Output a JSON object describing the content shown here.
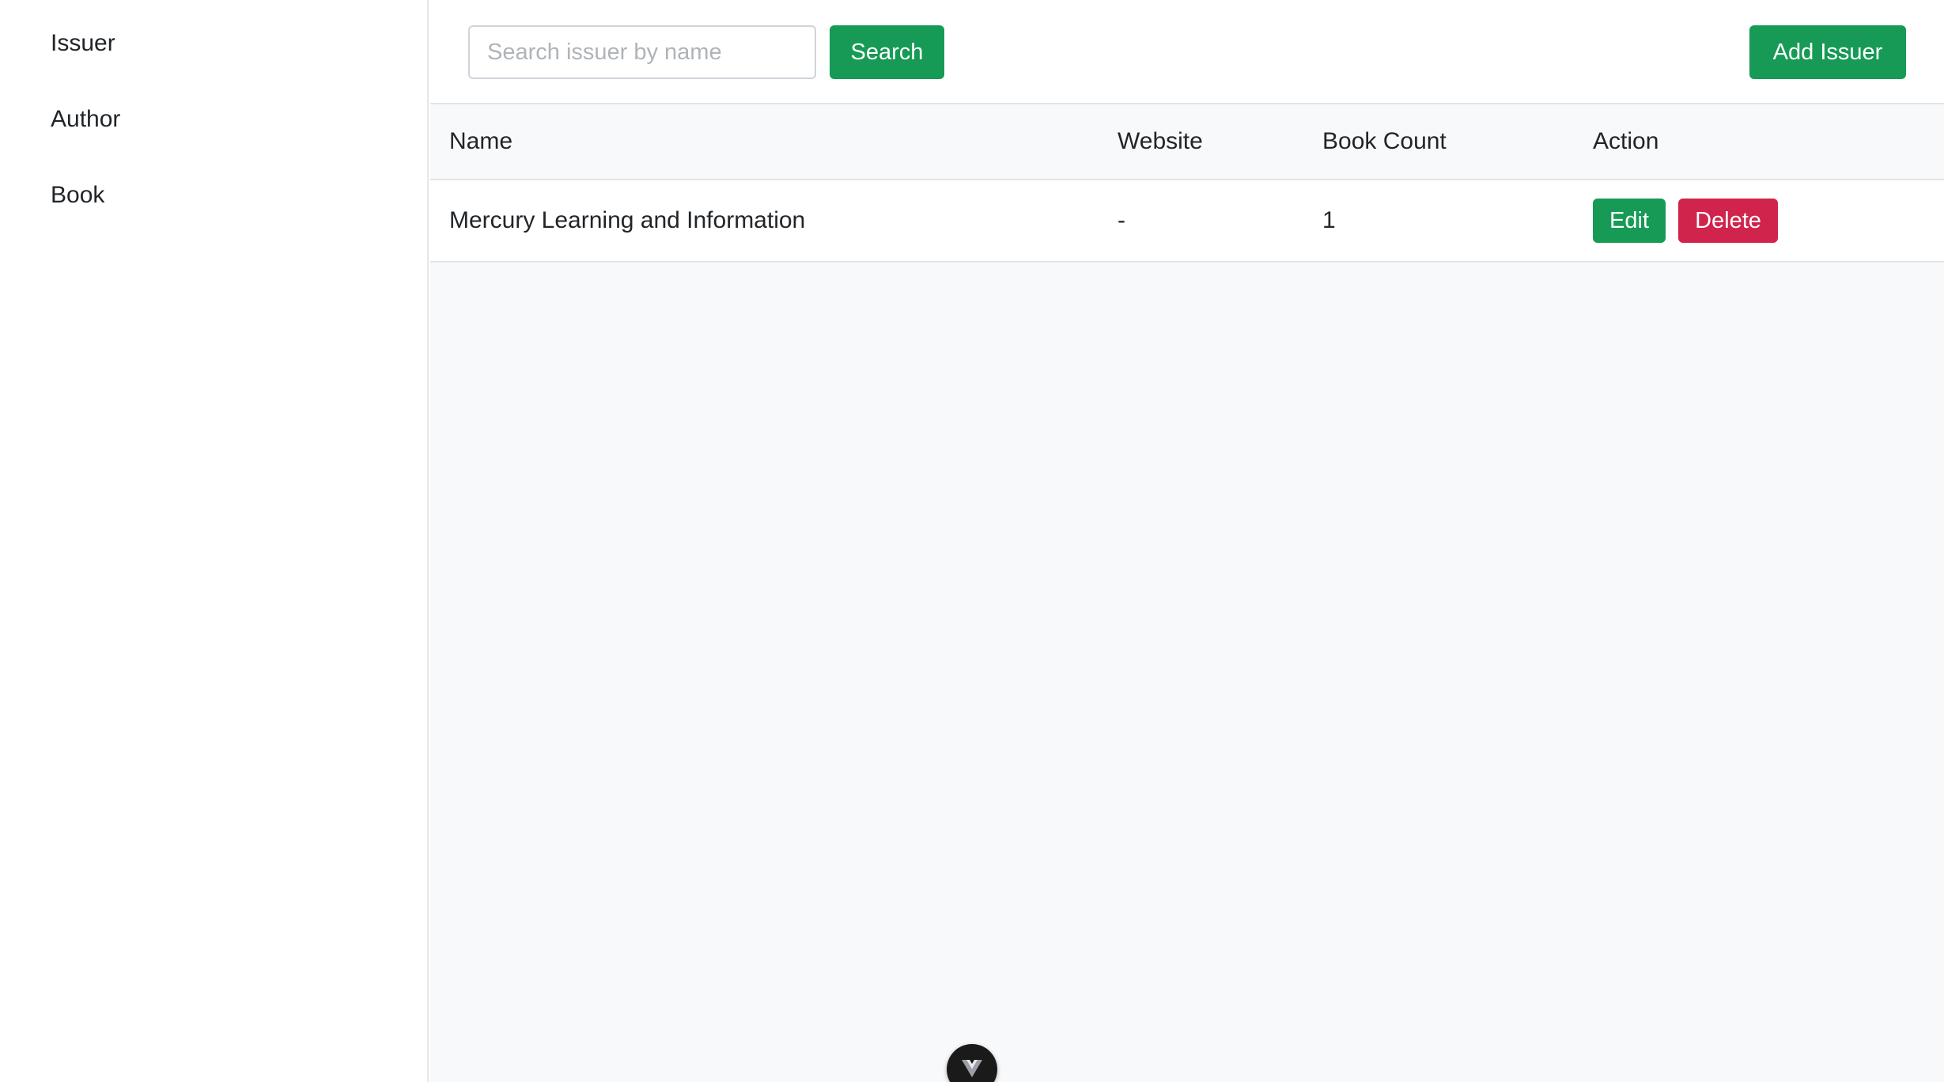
{
  "sidebar": {
    "items": [
      {
        "label": "Issuer"
      },
      {
        "label": "Author"
      },
      {
        "label": "Book"
      }
    ]
  },
  "toolbar": {
    "search_placeholder": "Search issuer by name",
    "search_value": "",
    "search_label": "Search",
    "add_label": "Add Issuer"
  },
  "table": {
    "headers": {
      "name": "Name",
      "website": "Website",
      "count": "Book Count",
      "action": "Action"
    },
    "rows": [
      {
        "name": "Mercury Learning and Information",
        "website": "-",
        "count": "1",
        "edit_label": "Edit",
        "delete_label": "Delete"
      }
    ]
  },
  "colors": {
    "success": "#169a55",
    "danger": "#d0244c"
  },
  "floating_badge": {
    "icon": "vue-devtools-icon"
  }
}
